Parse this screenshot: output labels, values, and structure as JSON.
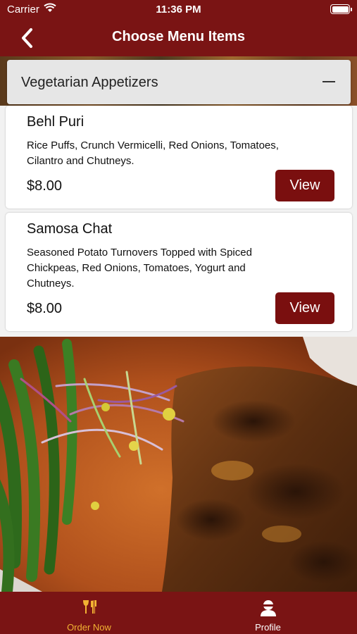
{
  "status_bar": {
    "carrier": "Carrier",
    "time": "11:36 PM"
  },
  "nav": {
    "title": "Choose Menu Items",
    "back_icon": "chevron-left-icon"
  },
  "section": {
    "title": "Vegetarian Appetizers",
    "toggle_icon": "minus-icon"
  },
  "items": [
    {
      "name": "Behl Puri",
      "description": "Rice Puffs, Crunch Vermicelli, Red Onions, Tomatoes, Cilantro and Chutneys.",
      "price": "$8.00",
      "button": "View"
    },
    {
      "name": "Samosa Chat",
      "description": "Seasoned Potato Turnovers Topped with Spiced Chickpeas, Red Onions, Tomatoes, Yogurt and Chutneys.",
      "price": "$8.00",
      "button": "View"
    }
  ],
  "tabs": [
    {
      "label": "Order Now",
      "icon": "fork-knife-icon",
      "active": true
    },
    {
      "label": "Profile",
      "icon": "user-icon",
      "active": false
    }
  ],
  "colors": {
    "brand": "#7a1414",
    "button": "#7a0f0f",
    "active_tab": "#f2b233"
  }
}
